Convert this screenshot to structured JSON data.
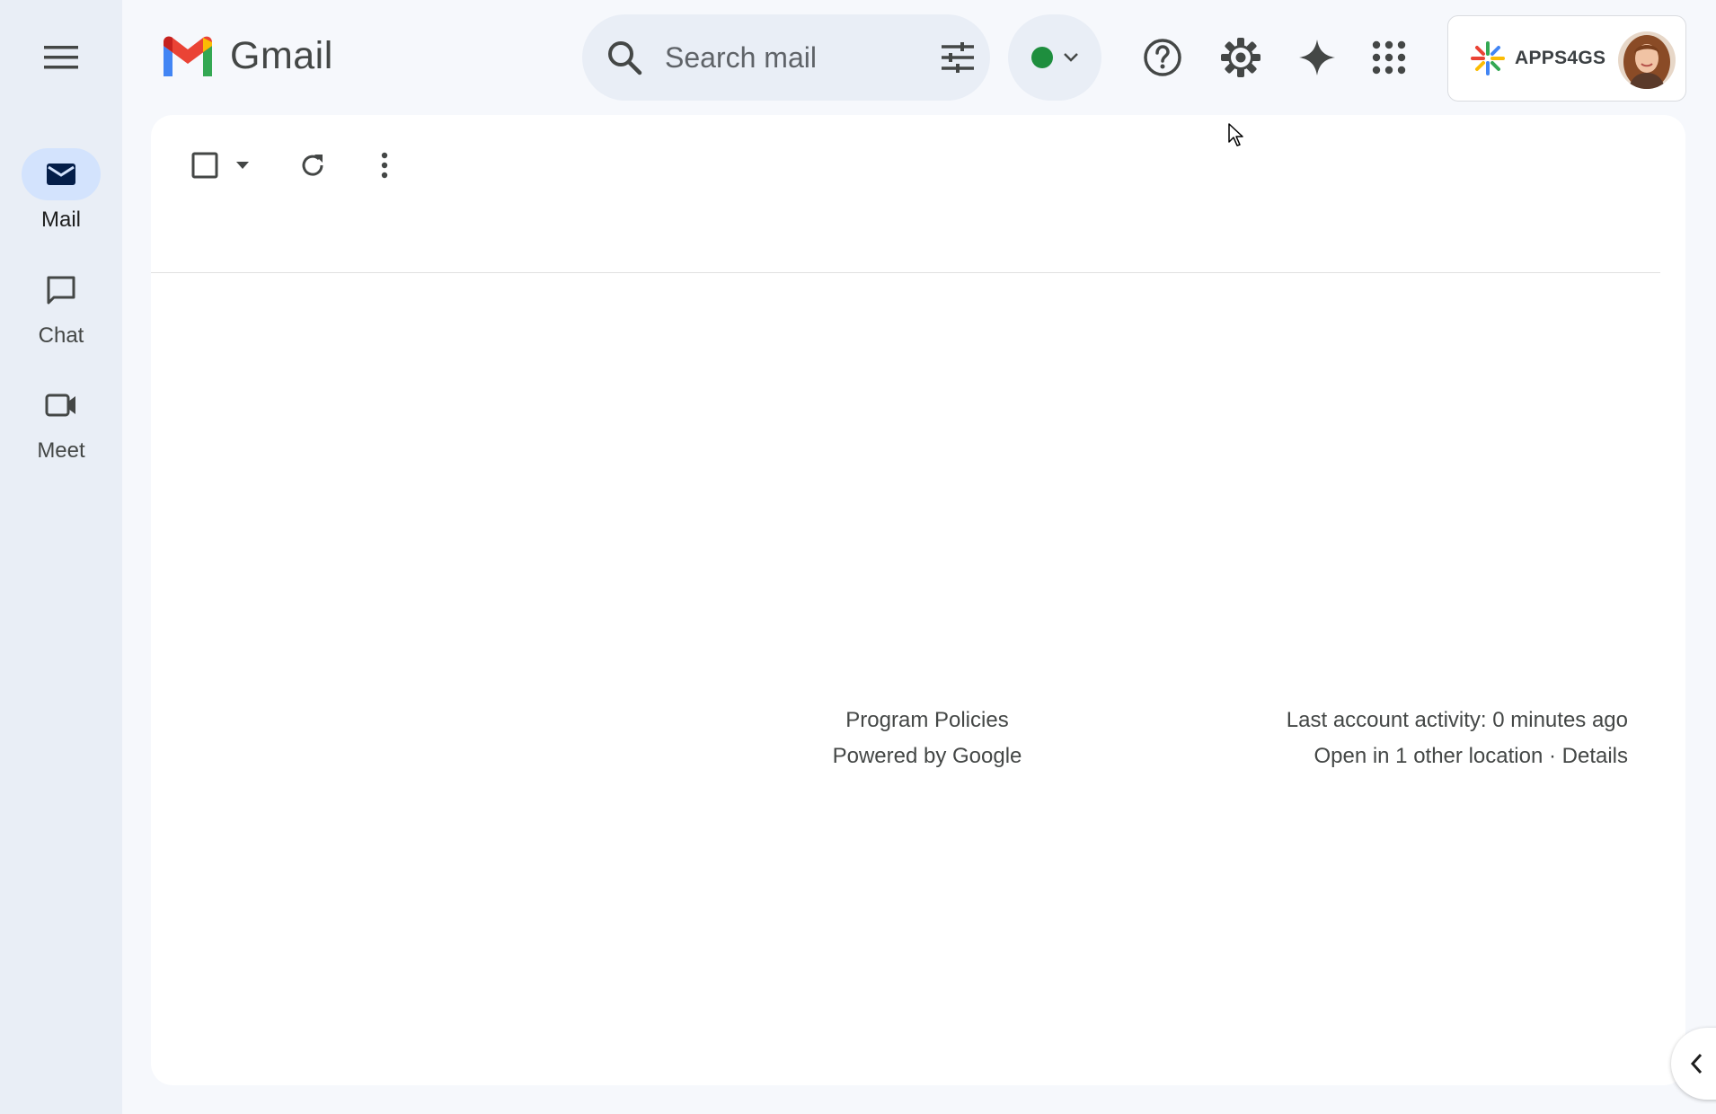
{
  "app": {
    "brand_name": "Gmail"
  },
  "rail": {
    "items": [
      {
        "label": "Mail",
        "icon": "mail-icon",
        "active": true
      },
      {
        "label": "Chat",
        "icon": "chat-icon",
        "active": false
      },
      {
        "label": "Meet",
        "icon": "meet-icon",
        "active": false
      }
    ]
  },
  "search": {
    "placeholder": "Search mail"
  },
  "status": {
    "indicator_color": "#1e8e3e",
    "state": "active"
  },
  "account": {
    "org_name": "APPS4GS"
  },
  "footer": {
    "program_policies": "Program Policies",
    "powered_by": "Powered by Google",
    "last_activity": "Last account activity: 0 minutes ago",
    "open_locations": "Open in 1 other location",
    "separator": "·",
    "details": "Details"
  },
  "colors": {
    "background": "#f6f8fc",
    "rail_active": "#d3e3fd",
    "search_bg": "#e9eef6",
    "text_secondary": "#444746"
  }
}
